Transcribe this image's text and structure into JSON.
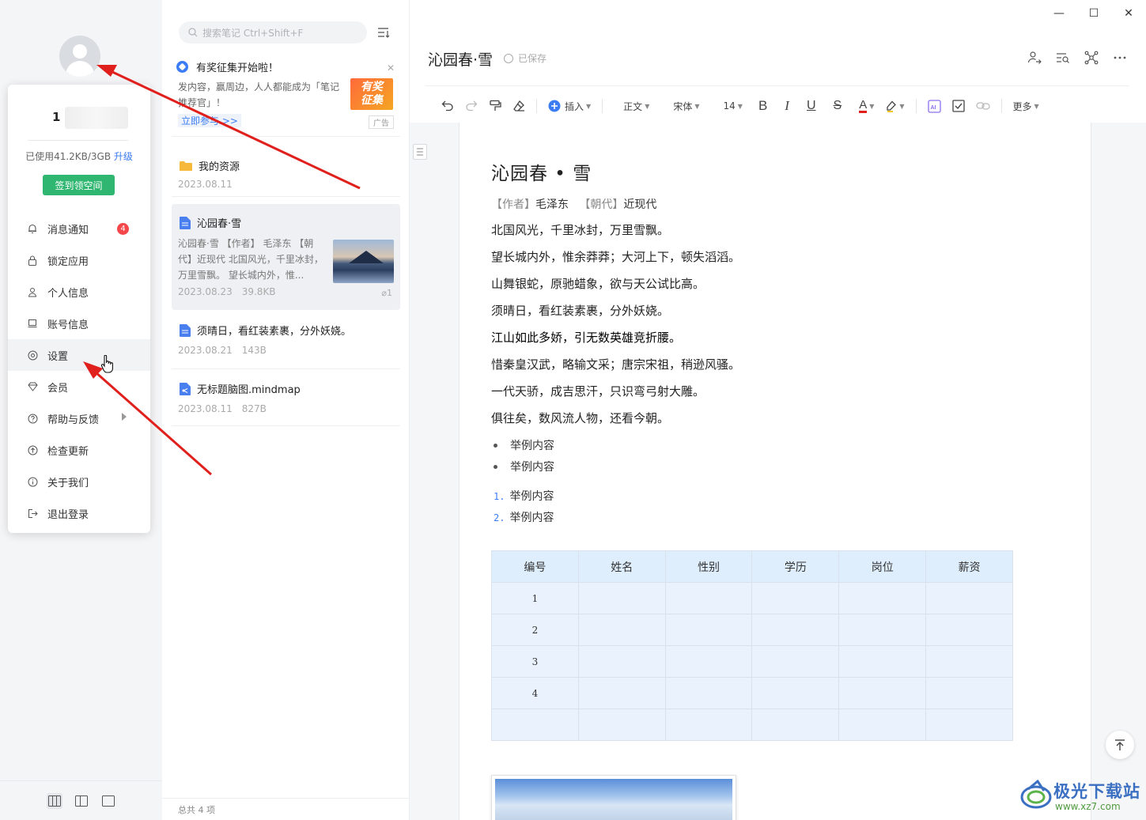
{
  "sidebar": {
    "user_name": "1",
    "storage_used": "已使用41.2KB/3GB",
    "upgrade_label": "升级",
    "checkin_label": "签到领空间",
    "menu": [
      {
        "label": "消息通知",
        "icon": "bell-icon",
        "badge": "4"
      },
      {
        "label": "锁定应用",
        "icon": "lock-icon"
      },
      {
        "label": "个人信息",
        "icon": "person-icon"
      },
      {
        "label": "账号信息",
        "icon": "account-icon"
      },
      {
        "label": "设置",
        "icon": "gear-icon"
      },
      {
        "label": "会员",
        "icon": "diamond-icon"
      },
      {
        "label": "帮助与反馈",
        "icon": "help-icon"
      },
      {
        "label": "检查更新",
        "icon": "update-icon"
      },
      {
        "label": "关于我们",
        "icon": "info-icon"
      },
      {
        "label": "退出登录",
        "icon": "logout-icon"
      }
    ]
  },
  "note_list": {
    "search_placeholder": "搜索笔记 Ctrl+Shift+F",
    "ad": {
      "title": "有奖征集开始啦！",
      "body": "发内容，赢周边，人人都能成为「笔记推荐官」！",
      "link": "立即参与 >>",
      "image_line1": "有奖",
      "image_line2": "征集",
      "tag": "广告"
    },
    "items": [
      {
        "title": "我的资源",
        "date": "2023.08.11",
        "icon": "folder-icon"
      },
      {
        "title": "沁园春·雪",
        "snippet": "沁园春·雪 【作者】 毛泽东 【朝代】近现代 北国风光，千里冰封，万里雪飘。 望长城内外，惟...",
        "date": "2023.08.23",
        "size": "39.8KB",
        "attachments": "1",
        "icon": "doc-icon"
      },
      {
        "title": "须晴日，看红装素裹，分外妖娆。",
        "date": "2023.08.21",
        "size": "143B",
        "icon": "doc-icon"
      },
      {
        "title": "无标题脑图.mindmap",
        "date": "2023.08.11",
        "size": "827B",
        "icon": "mindmap-icon"
      }
    ],
    "footer": "总共 4 项"
  },
  "editor": {
    "title": "沁园春·雪",
    "saved": "已保存",
    "toolbar": {
      "insert": "插入",
      "paragraph": "正文",
      "font": "宋体",
      "size": "14",
      "more": "更多"
    },
    "doc": {
      "heading": "沁园春 • 雪",
      "meta_author_label": "【作者】",
      "meta_author": "毛泽东",
      "meta_dynasty_label": "【朝代】",
      "meta_dynasty": "近现代",
      "lines": [
        "北国风光，千里冰封，万里雪飘。",
        "望长城内外，惟余莽莽；大河上下，顿失滔滔。",
        "山舞银蛇，原驰蜡象，欲与天公试比高。",
        "须晴日，看红装素裹，分外妖娆。",
        "江山如此多娇，引无数英雄竞折腰。",
        "惜秦皇汉武，略输文采；唐宗宋祖，稍逊风骚。",
        "一代天骄，成吉思汗，只识弯弓射大雕。",
        "俱往矣，数风流人物，还看今朝。"
      ],
      "bullets": [
        "举例内容",
        "举例内容"
      ],
      "numbered": [
        {
          "n": "1.",
          "text": "举例内容"
        },
        {
          "n": "2.",
          "text": "举例内容"
        }
      ],
      "table": {
        "headers": [
          "编号",
          "姓名",
          "性别",
          "学历",
          "岗位",
          "薪资"
        ],
        "rows": [
          [
            "1",
            "",
            "",
            "",
            "",
            ""
          ],
          [
            "2",
            "",
            "",
            "",
            "",
            ""
          ],
          [
            "3",
            "",
            "",
            "",
            "",
            ""
          ],
          [
            "4",
            "",
            "",
            "",
            "",
            ""
          ],
          [
            "",
            "",
            "",
            "",
            "",
            ""
          ]
        ]
      }
    }
  },
  "watermark": {
    "text": "极光下载站",
    "url": "www.xz7.com"
  },
  "colors": {
    "accent": "#3b7cf5",
    "checkin_green": "#2fb670",
    "badge_red": "#f5474a",
    "arrow_red": "#e0201c"
  }
}
